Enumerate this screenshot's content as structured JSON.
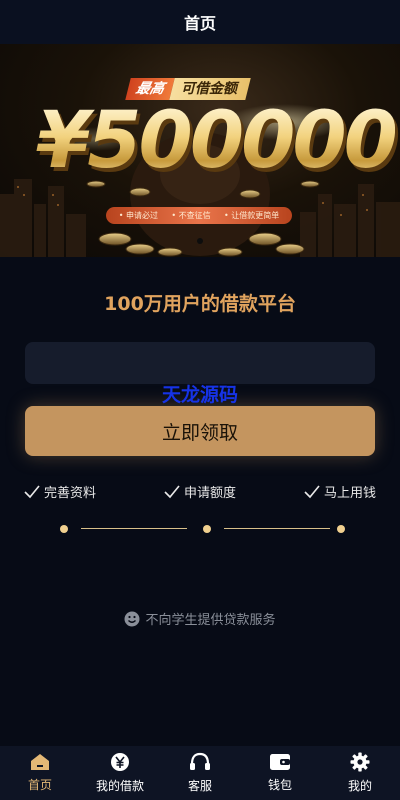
{
  "header": {
    "title": "首页"
  },
  "banner": {
    "tag_left": "最高",
    "tag_right": "可借金额",
    "amount": "¥500000",
    "features": [
      "• 申请必过",
      "• 不查征信",
      "• 让借款更简单"
    ]
  },
  "main": {
    "headline": "100万用户的借款平台",
    "input": {
      "value": "",
      "placeholder": ""
    },
    "watermark": "天龙源码",
    "apply_label": "立即领取",
    "steps": [
      "完善资料",
      "申请额度",
      "马上用钱"
    ],
    "notice": "不向学生提供贷款服务"
  },
  "tabbar": {
    "items": [
      {
        "label": "首页",
        "icon": "home-icon",
        "active": true
      },
      {
        "label": "我的借款",
        "icon": "yuan-icon",
        "active": false
      },
      {
        "label": "客服",
        "icon": "headset-icon",
        "active": false
      },
      {
        "label": "钱包",
        "icon": "wallet-icon",
        "active": false
      },
      {
        "label": "我的",
        "icon": "gear-icon",
        "active": false
      }
    ]
  },
  "colors": {
    "accent": "#c4955f",
    "headline": "#e0a35e",
    "active_tab": "#e3b876",
    "background": "#070b16"
  }
}
